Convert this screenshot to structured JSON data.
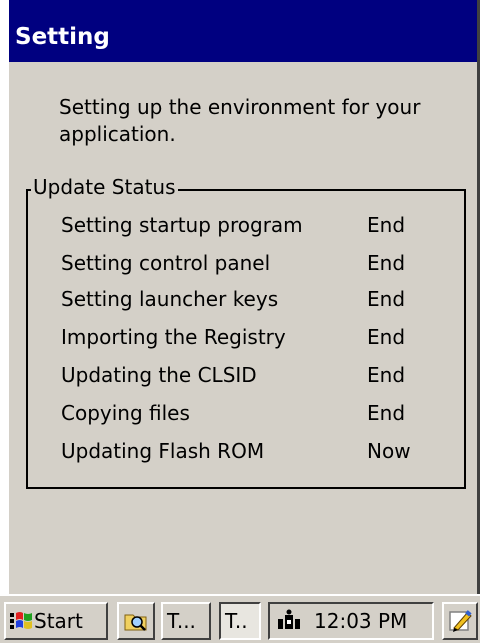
{
  "window": {
    "title": "Setting",
    "description": "Setting up the environment for your application."
  },
  "update_status": {
    "group_title": "Update Status",
    "items": [
      {
        "task": "Setting startup program",
        "status": "End"
      },
      {
        "task": "Setting control panel",
        "status": "End"
      },
      {
        "task": "Setting launcher keys",
        "status": "End"
      },
      {
        "task": "Importing the Registry",
        "status": "End"
      },
      {
        "task": "Updating the CLSID",
        "status": "End"
      },
      {
        "task": "Copying files",
        "status": "End"
      },
      {
        "task": "Updating Flash ROM",
        "status": "Now"
      }
    ]
  },
  "taskbar": {
    "start_label": "Start",
    "task1_label": "T...",
    "task2_label": "T..",
    "clock": "12:03 PM",
    "icons": {
      "start": "windows-flag-icon",
      "explorer": "explorer-icon",
      "network": "network-icon",
      "input_panel": "input-panel-icon"
    }
  },
  "colors": {
    "titlebar": "#000080",
    "window_bg": "#d4d0c8"
  }
}
